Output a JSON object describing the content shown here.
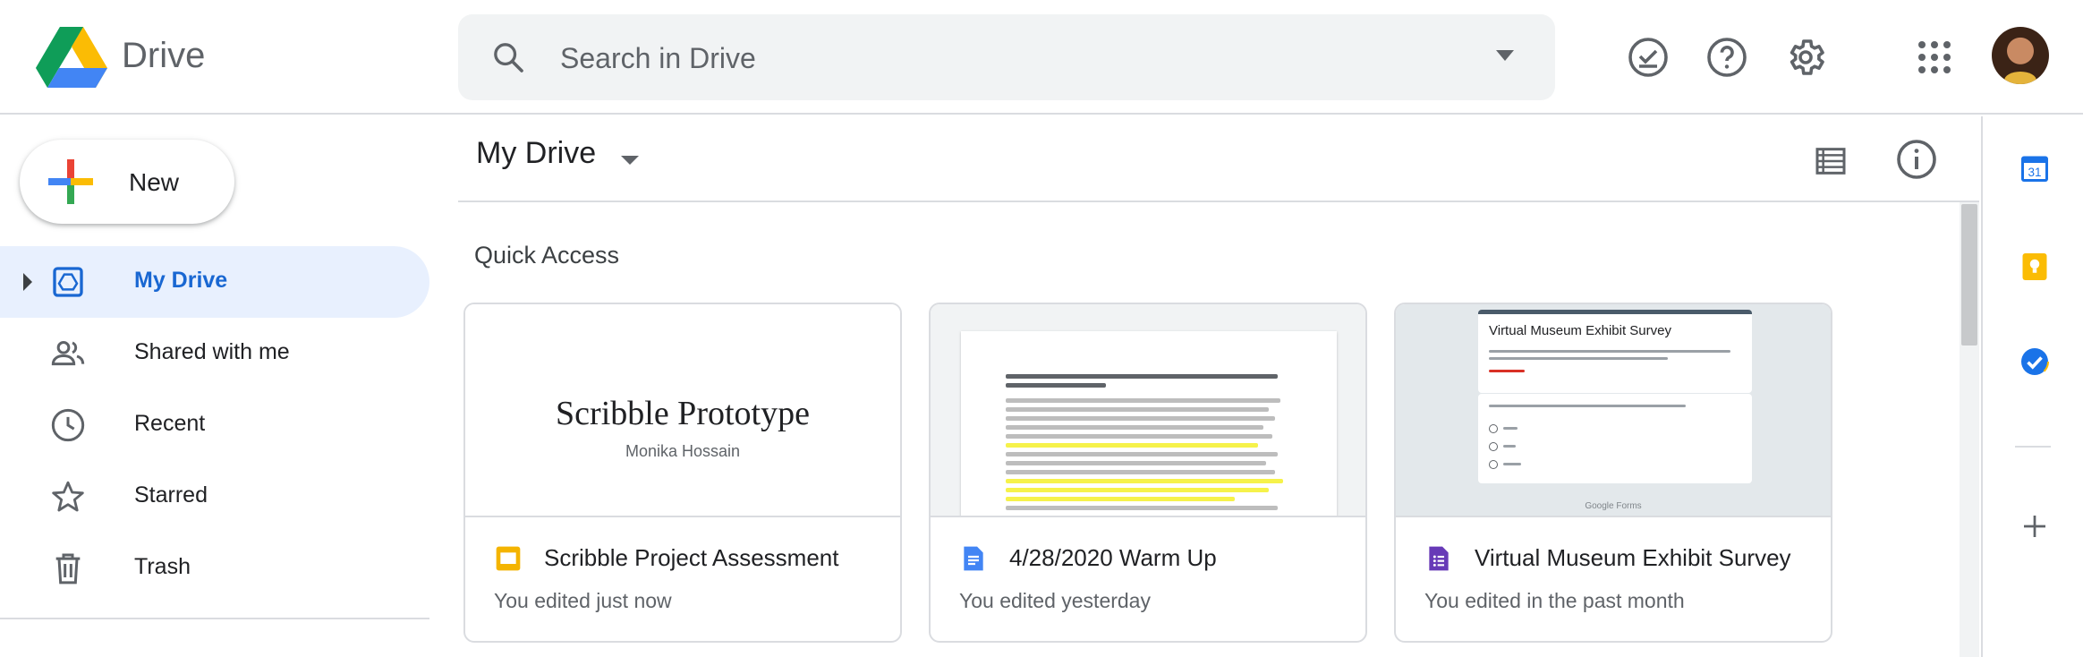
{
  "header": {
    "app_name": "Drive",
    "search_placeholder": "Search in Drive"
  },
  "sidebar": {
    "new_label": "New",
    "items": [
      {
        "label": "My Drive",
        "icon": "my-drive-icon",
        "active": true
      },
      {
        "label": "Shared with me",
        "icon": "shared-icon"
      },
      {
        "label": "Recent",
        "icon": "clock-icon"
      },
      {
        "label": "Starred",
        "icon": "star-icon"
      },
      {
        "label": "Trash",
        "icon": "trash-icon"
      }
    ]
  },
  "main": {
    "title": "My Drive",
    "section_title": "Quick Access",
    "cards": [
      {
        "title": "Scribble Project Assessment",
        "subtitle": "You edited just now",
        "type": "slides",
        "thumb_title": "Scribble Prototype",
        "thumb_author": "Monika Hossain"
      },
      {
        "title": "4/28/2020 Warm Up",
        "subtitle": "You edited yesterday",
        "type": "docs"
      },
      {
        "title": "Virtual Museum Exhibit Survey",
        "subtitle": "You edited in the past month",
        "type": "forms",
        "thumb_title": "Virtual Museum Exhibit Survey",
        "thumb_footer": "Google Forms"
      }
    ]
  },
  "right_panel": {
    "calendar_day": "31"
  },
  "colors": {
    "accent_blue": "#1967d2",
    "active_bg": "#e8f0fe",
    "slides_yellow": "#f4b400",
    "docs_blue": "#4285f4",
    "forms_purple": "#673ab7"
  }
}
